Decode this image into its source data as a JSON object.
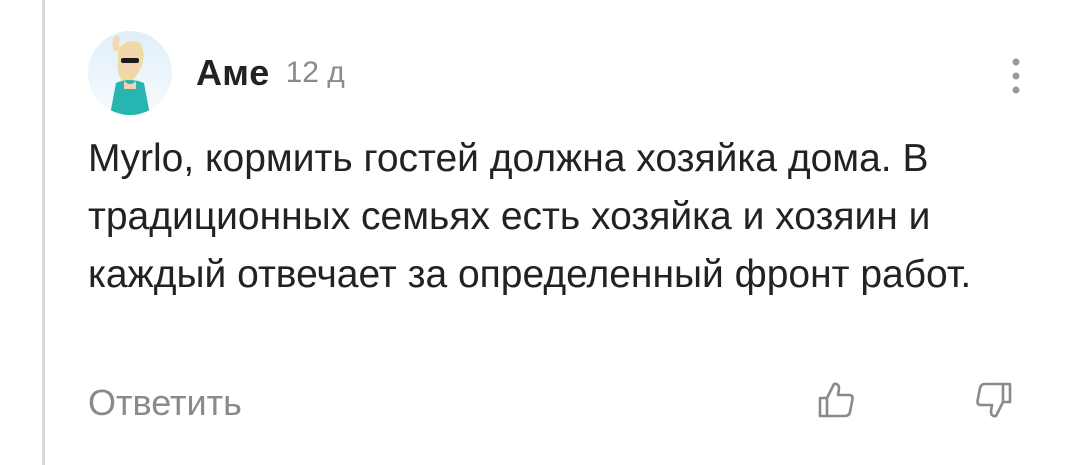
{
  "comment": {
    "author": "Аме",
    "time": "12 д",
    "text": "Myrlo, кормить гостей должна хозяйка дома. В традиционных семьях есть хозяйка и хозяин и каждый отвечает за определенный фронт работ.",
    "reply_label": "Ответить"
  },
  "icons": {
    "more": "vertical-dots-icon",
    "like": "thumbs-up-icon",
    "dislike": "thumbs-down-icon"
  },
  "colors": {
    "text": "#222222",
    "muted": "#8a8a8a",
    "thread_line": "#d9d9d9"
  }
}
